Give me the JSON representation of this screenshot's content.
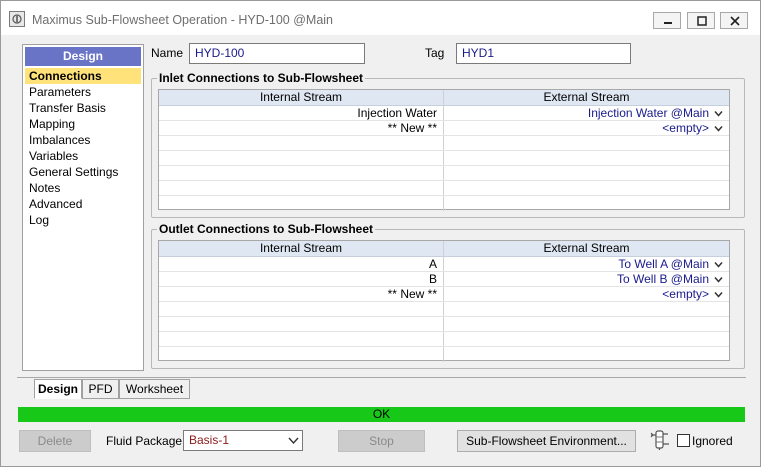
{
  "window": {
    "title": "Maximus Sub-Flowsheet Operation - HYD-100 @Main",
    "icons": [
      "app-icon",
      "minimize-icon",
      "maximize-icon",
      "close-icon"
    ]
  },
  "nav": {
    "header": "Design",
    "items": [
      {
        "label": "Connections",
        "selected": true
      },
      {
        "label": "Parameters"
      },
      {
        "label": "Transfer Basis"
      },
      {
        "label": "Mapping"
      },
      {
        "label": "Imbalances"
      },
      {
        "label": "Variables"
      },
      {
        "label": "General Settings"
      },
      {
        "label": "Notes"
      },
      {
        "label": "Advanced"
      },
      {
        "label": "Log"
      }
    ]
  },
  "form": {
    "name_label": "Name",
    "name_value": "HYD-100",
    "tag_label": "Tag",
    "tag_value": "HYD1"
  },
  "inlet": {
    "title": "Inlet Connections to Sub-Flowsheet",
    "columns": [
      "Internal Stream",
      "External Stream"
    ],
    "rows": [
      {
        "internal": "Injection Water",
        "external": "Injection Water @Main"
      },
      {
        "internal": "** New **",
        "external": "<empty>"
      }
    ]
  },
  "outlet": {
    "title": "Outlet Connections to Sub-Flowsheet",
    "columns": [
      "Internal Stream",
      "External Stream"
    ],
    "rows": [
      {
        "internal": "A",
        "external": "To Well A @Main"
      },
      {
        "internal": "B",
        "external": "To Well B @Main"
      },
      {
        "internal": "** New **",
        "external": "<empty>"
      }
    ]
  },
  "tabs": [
    {
      "label": "Design",
      "active": true
    },
    {
      "label": "PFD"
    },
    {
      "label": "Worksheet"
    }
  ],
  "status": {
    "text": "OK",
    "color": "#18c818"
  },
  "footer": {
    "delete_label": "Delete",
    "fluid_package_label": "Fluid Package",
    "fluid_package_value": "Basis-1",
    "stop_label": "Stop",
    "env_button_label": "Sub-Flowsheet Environment...",
    "ignored_label": "Ignored",
    "ignored_checked": false
  },
  "colors": {
    "nav_header": "#6a74c6",
    "nav_selected": "#ffe27a",
    "link_text": "#1a1a8c",
    "grid_header": "#dfe7f2"
  }
}
